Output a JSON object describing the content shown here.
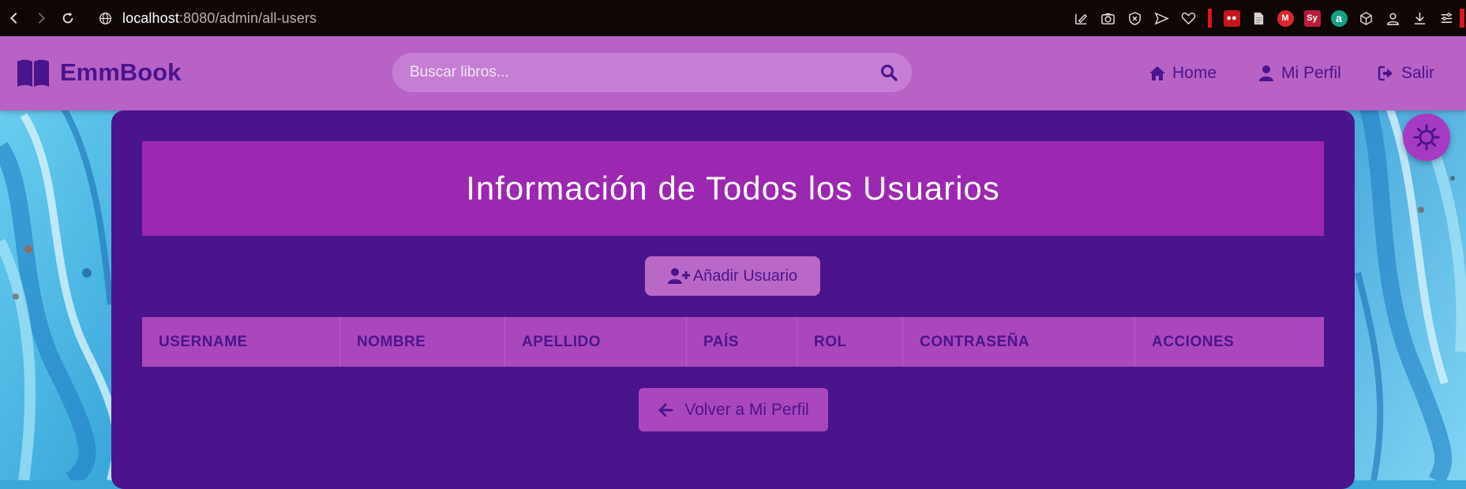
{
  "browser": {
    "url_host": "localhost",
    "url_rest": ":8080/admin/all-users"
  },
  "header": {
    "brand": "EmmBook",
    "search_placeholder": "Buscar libros...",
    "nav": [
      {
        "label": "Home",
        "icon": "home-icon"
      },
      {
        "label": "Mi Perfil",
        "icon": "user-icon"
      },
      {
        "label": "Salir",
        "icon": "sign-out-icon"
      }
    ]
  },
  "main": {
    "title": "Información de Todos los Usuarios",
    "add_user_label": "Añadir Usuario",
    "table_headers": [
      "USERNAME",
      "NOMBRE",
      "APELLIDO",
      "PAÍS",
      "ROL",
      "CONTRASEÑA",
      "ACCIONES"
    ],
    "back_label": "Volver a Mi Perfil"
  },
  "colors": {
    "header_bg": "#b862c6",
    "card_bg": "#4a148c",
    "banner_bg": "#9c27b0",
    "table_head_bg": "#ab47bc",
    "accent_text": "#4a148c"
  }
}
